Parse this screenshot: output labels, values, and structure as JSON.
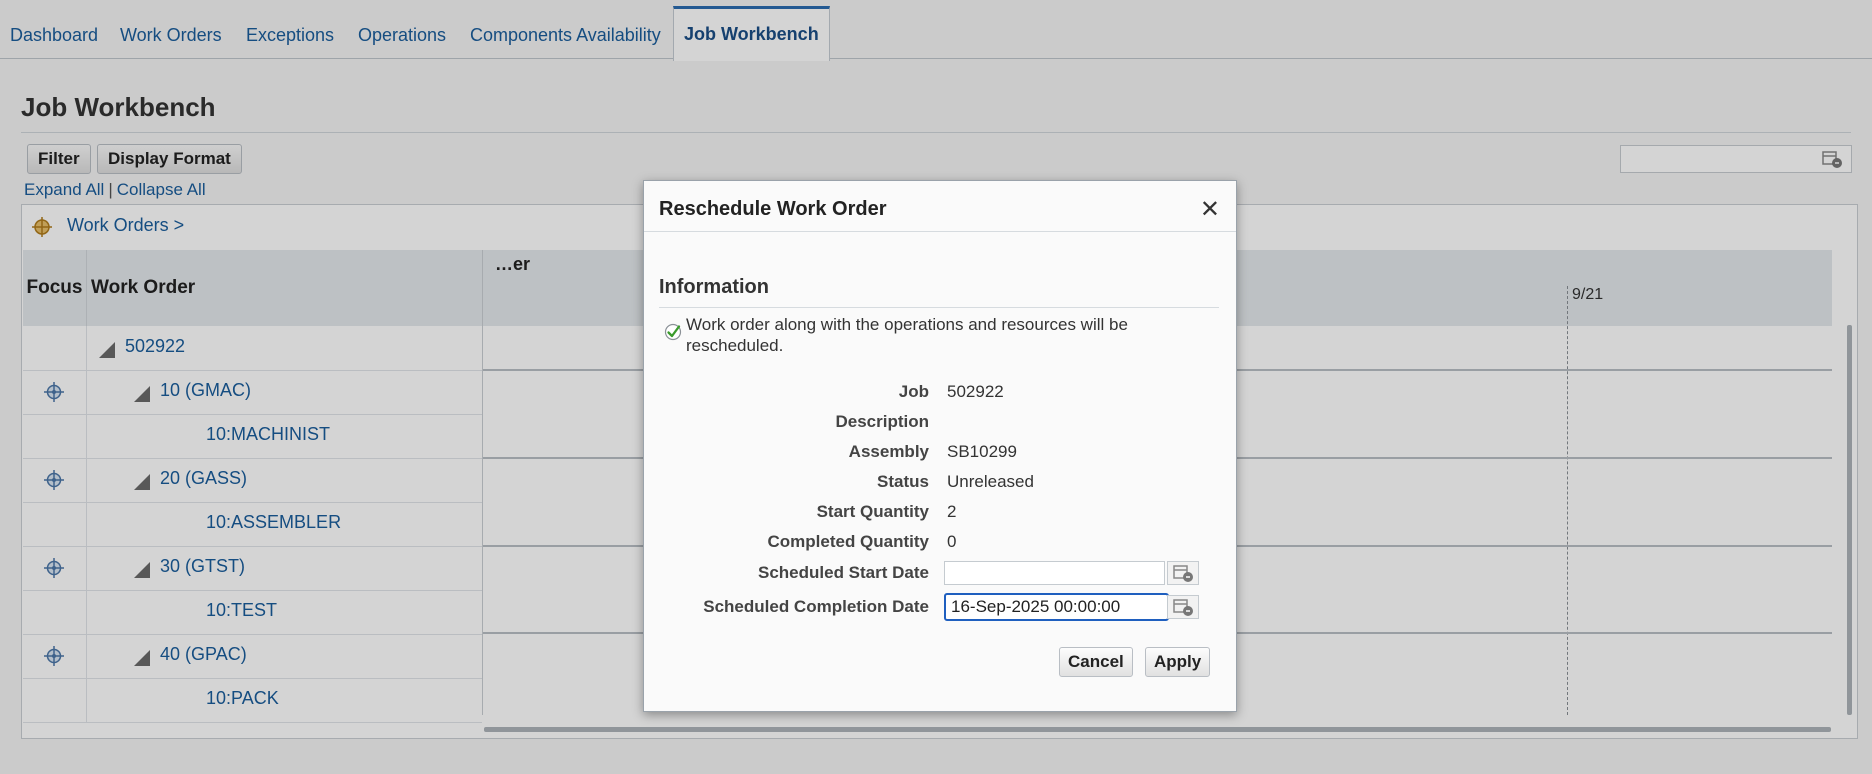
{
  "tabs": [
    {
      "label": "Dashboard",
      "active": false
    },
    {
      "label": "Work Orders",
      "active": false
    },
    {
      "label": "Exceptions",
      "active": false
    },
    {
      "label": "Operations",
      "active": false
    },
    {
      "label": "Components Availability",
      "active": false
    },
    {
      "label": "Job Workbench",
      "active": true
    }
  ],
  "page": {
    "title": "Job Workbench",
    "filter_label": "Filter",
    "display_format_label": "Display Format",
    "expand_all": "Expand All",
    "link_separator": "|",
    "collapse_all": "Collapse All",
    "breadcrumb": "Work Orders  >"
  },
  "grid": {
    "col_focus": "Focus",
    "col_work_order": "Work Order",
    "gantt_header": "…er",
    "date_marker": "9/21",
    "rows": [
      {
        "label": "502922",
        "level": 0,
        "focus": false,
        "expandable": true
      },
      {
        "label": "10 (GMAC)",
        "level": 1,
        "focus": true,
        "expandable": true
      },
      {
        "label": "10:MACHINIST",
        "level": 2,
        "focus": false,
        "expandable": false
      },
      {
        "label": "20 (GASS)",
        "level": 1,
        "focus": true,
        "expandable": true
      },
      {
        "label": "10:ASSEMBLER",
        "level": 2,
        "focus": false,
        "expandable": false
      },
      {
        "label": "30 (GTST)",
        "level": 1,
        "focus": true,
        "expandable": true
      },
      {
        "label": "10:TEST",
        "level": 2,
        "focus": false,
        "expandable": false
      },
      {
        "label": "40 (GPAC)",
        "level": 1,
        "focus": true,
        "expandable": true
      },
      {
        "label": "10:PACK",
        "level": 2,
        "focus": false,
        "expandable": false
      }
    ]
  },
  "dialog": {
    "title": "Reschedule Work Order",
    "close_glyph": "✕",
    "section": "Information",
    "info_message": "Work order along with the operations and resources will be rescheduled.",
    "fields": {
      "job": {
        "label": "Job",
        "value": "502922"
      },
      "description": {
        "label": "Description",
        "value": ""
      },
      "assembly": {
        "label": "Assembly",
        "value": "SB10299"
      },
      "status": {
        "label": "Status",
        "value": "Unreleased"
      },
      "start_quantity": {
        "label": "Start Quantity",
        "value": "2"
      },
      "completed_quantity": {
        "label": "Completed Quantity",
        "value": "0"
      },
      "scheduled_start": {
        "label": "Scheduled Start Date",
        "value": ""
      },
      "scheduled_completion": {
        "label": "Scheduled Completion Date",
        "value": "16-Sep-2025 00:00:00"
      }
    },
    "cancel_label": "Cancel",
    "apply_label": "Apply"
  },
  "colors": {
    "link": "#1a5d9c",
    "accent": "#2b6cb0",
    "focus_border": "#1f5fbf",
    "success": "#3a9b2c"
  }
}
